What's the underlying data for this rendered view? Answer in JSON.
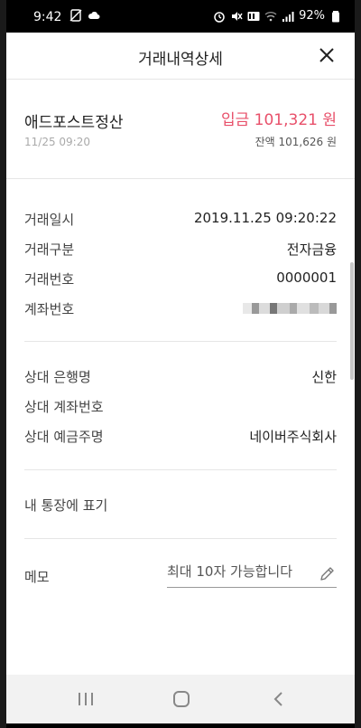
{
  "status_bar": {
    "time": "9:42",
    "battery": "92%",
    "icons_left": [
      "no-sim-icon",
      "cloud-icon"
    ],
    "icons_right": [
      "alarm-icon",
      "mute-icon",
      "hd-voice-icon",
      "wifi-icon",
      "signal-icon",
      "battery-icon"
    ]
  },
  "header": {
    "title": "거래내역상세",
    "close_icon": "close-icon"
  },
  "summary": {
    "merchant": "애드포스트정산",
    "datetime": "11/25 09:20",
    "amount": "입금 101,321 원",
    "balance": "잔액 101,626 원",
    "amount_color": "#e8506a"
  },
  "details": [
    {
      "label": "거래일시",
      "value": "2019.11.25 09:20:22"
    },
    {
      "label": "거래구분",
      "value": "전자금융"
    },
    {
      "label": "거래번호",
      "value": "0000001"
    },
    {
      "label": "계좌번호",
      "value": ""
    }
  ],
  "counterparty": [
    {
      "label": "상대 은행명",
      "value": "신한"
    },
    {
      "label": "상대 계좌번호",
      "value": ""
    },
    {
      "label": "상대 예금주명",
      "value": "네이버주식회사"
    }
  ],
  "passbook_label": "내 통장에 표기",
  "memo": {
    "label": "메모",
    "placeholder": "최대 10자 가능합니다",
    "value": ""
  },
  "navbar": {
    "buttons": [
      "recent-apps-icon",
      "home-icon",
      "back-icon"
    ]
  }
}
